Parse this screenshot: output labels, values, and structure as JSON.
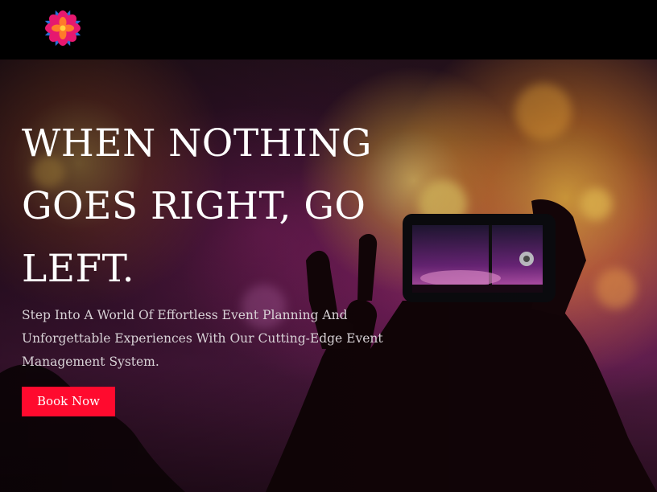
{
  "header": {
    "logo_icon": "lotus-flower-logo-icon"
  },
  "hero": {
    "headline_lines": [
      "WHEN NOTHING",
      "GOES RIGHT, GO",
      "LEFT."
    ],
    "subtext": "Step Into A World Of Effortless Event Planning And Unforgettable Experiences With Our Cutting-Edge Event Management System.",
    "cta_label": "Book Now",
    "background_image": "concert-crowd-phone-photo"
  },
  "colors": {
    "accent": "#ff0a2e",
    "header_bg": "#000000",
    "headline": "#ffffff",
    "subtext": "#d8d2d6"
  }
}
